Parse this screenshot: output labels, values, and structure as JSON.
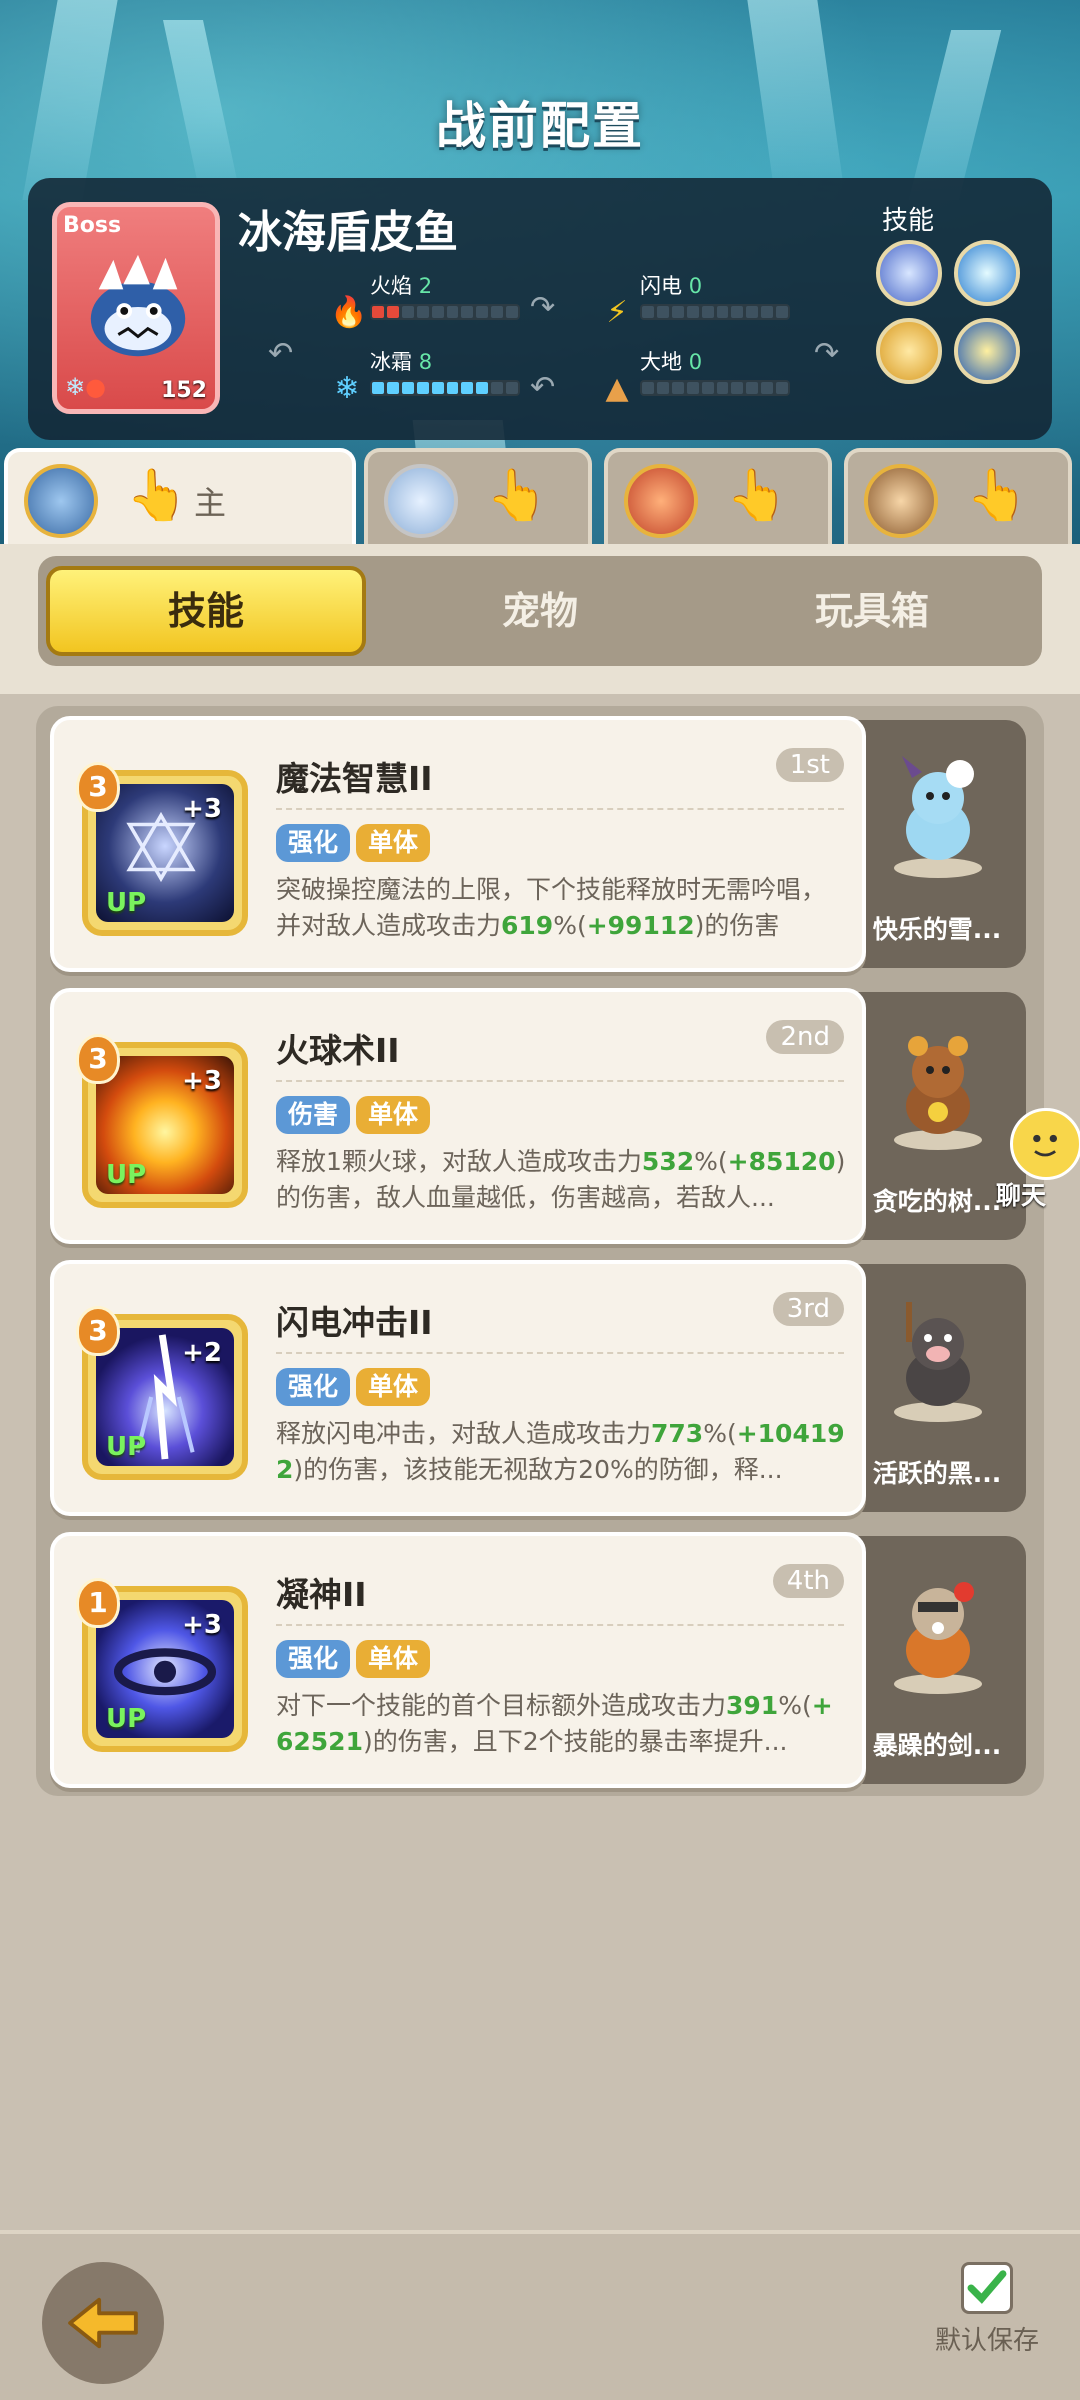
{
  "title": "战前配置",
  "boss": {
    "tag": "Boss",
    "name": "冰海盾皮鱼",
    "level": "152",
    "skills_label": "技能",
    "stats": [
      {
        "label": "火焰",
        "value": "2",
        "filled": 2,
        "total": 10,
        "color": "#e74a3a",
        "icon": "fire-icon"
      },
      {
        "label": "闪电",
        "value": "0",
        "filled": 0,
        "total": 10,
        "color": "#f2c520",
        "icon": "lightning-icon"
      },
      {
        "label": "冰霜",
        "value": "8",
        "filled": 8,
        "total": 10,
        "color": "#5fcfff",
        "icon": "frost-icon"
      },
      {
        "label": "大地",
        "value": "0",
        "filled": 0,
        "total": 10,
        "color": "#e8a04a",
        "icon": "earth-icon"
      }
    ]
  },
  "heroes": {
    "main_label": "主"
  },
  "categories": {
    "skill": "技能",
    "pet": "宠物",
    "toybox": "玩具箱",
    "active": "skill"
  },
  "skills": [
    {
      "level": "3",
      "plus": "+3",
      "up": "UP",
      "name": "魔法智慧II",
      "rank": "1st",
      "tags": [
        "强化",
        "单体"
      ],
      "desc_a": "突破操控魔法的上限，下个技能释放时无需吟唱，并对敌人造成攻击力",
      "desc_v1": "619",
      "desc_b": "%(",
      "desc_v2": "+99112",
      "desc_c": ")的伤害",
      "pet_name": "快乐的雪..."
    },
    {
      "level": "3",
      "plus": "+3",
      "up": "UP",
      "name": "火球术II",
      "rank": "2nd",
      "tags": [
        "伤害",
        "单体"
      ],
      "desc_a": "释放1颗火球，对敌人造成攻击力",
      "desc_v1": "532",
      "desc_b": "%(",
      "desc_v2": "+85120",
      "desc_c": ")的伤害，敌人血量越低，伤害越高，若敌人...",
      "pet_name": "贪吃的树..."
    },
    {
      "level": "3",
      "plus": "+2",
      "up": "UP",
      "name": "闪电冲击II",
      "rank": "3rd",
      "tags": [
        "强化",
        "单体"
      ],
      "desc_a": "释放闪电冲击，对敌人造成攻击力",
      "desc_v1": "773",
      "desc_b": "%(",
      "desc_v2": "+104192",
      "desc_c": ")的伤害，该技能无视敌方20%的防御，释...",
      "pet_name": "活跃的黑..."
    },
    {
      "level": "1",
      "plus": "+3",
      "up": "UP",
      "name": "凝神II",
      "rank": "4th",
      "tags": [
        "强化",
        "单体"
      ],
      "desc_a": "对下一个技能的首个目标额外造成攻击力",
      "desc_v1": "391",
      "desc_b": "%(",
      "desc_v2": "+62521",
      "desc_c": ")的伤害，且下2个技能的暴击率提升...",
      "pet_name": "暴躁的剑..."
    }
  ],
  "chat_label": "聊天",
  "save_label": "默认保存"
}
